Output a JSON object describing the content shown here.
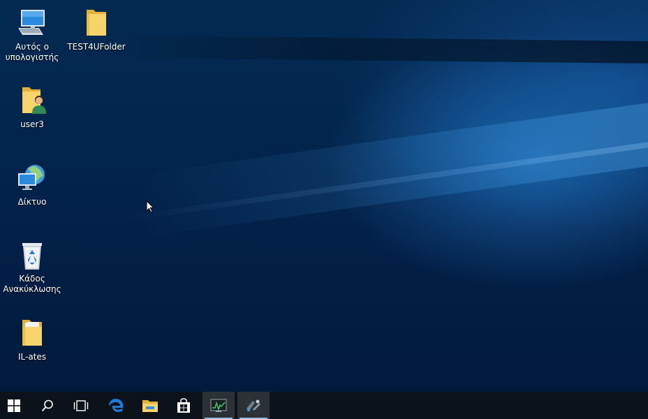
{
  "desktop": {
    "icons": [
      {
        "label": "Αυτός ο υπολογιστής",
        "icon": "this-pc-icon"
      },
      {
        "label": "TEST4UFolder",
        "icon": "folder-icon"
      },
      {
        "label": "user3",
        "icon": "user-folder-icon"
      },
      {
        "label": "Δίκτυο",
        "icon": "network-icon"
      },
      {
        "label": "Κάδος Ανακύκλωσης",
        "icon": "recycle-bin-icon"
      },
      {
        "label": "IL-ates",
        "icon": "folder-icon"
      }
    ]
  },
  "taskbar": {
    "items": [
      {
        "icon": "windows-start-icon"
      },
      {
        "icon": "search-icon"
      },
      {
        "icon": "task-view-icon"
      },
      {
        "icon": "edge-icon"
      },
      {
        "icon": "file-explorer-icon"
      },
      {
        "icon": "store-icon"
      },
      {
        "icon": "performance-monitor-icon",
        "active": true
      },
      {
        "icon": "app-icon",
        "active": true
      }
    ]
  },
  "colors": {
    "taskbar_bg": "#0c1219",
    "folder_yellow": "#f3c94c",
    "accent_blue": "#1e7ad8"
  }
}
